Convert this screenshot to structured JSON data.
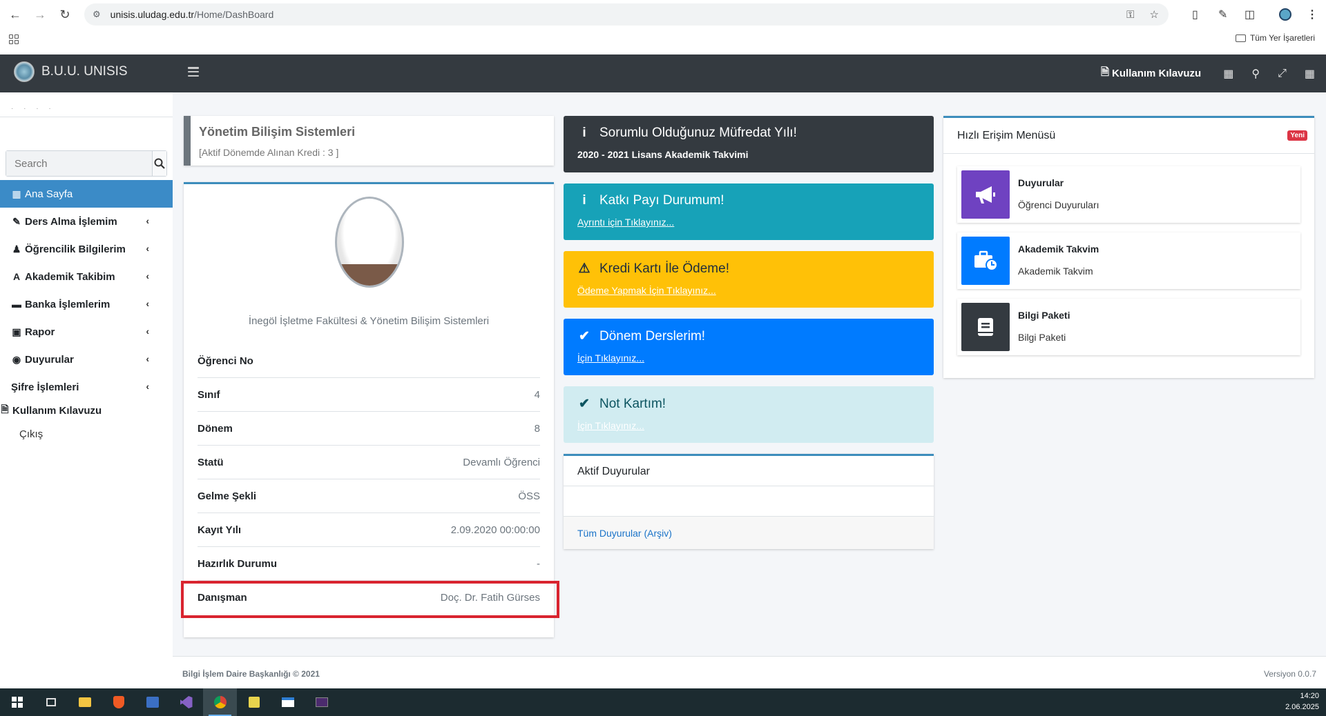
{
  "browser": {
    "url_host": "unisis.uludag.edu.tr",
    "url_path": "/Home/DashBoard",
    "bookmarks_all": "Tüm Yer İşaretleri"
  },
  "header": {
    "brand": "B.U.U. UNISIS",
    "guide": "Kullanım Kılavuzu"
  },
  "sidebar": {
    "search_placeholder": "Search",
    "items": [
      {
        "label": "Ana Sayfa",
        "icon": "dashboard-icon"
      },
      {
        "label": "Ders Alma İşlemim",
        "icon": "pencil-icon"
      },
      {
        "label": "Öğrencilik Bilgilerim",
        "icon": "graduate-icon"
      },
      {
        "label": "Akademik Takibim",
        "icon": "font-icon"
      },
      {
        "label": "Banka İşlemlerim",
        "icon": "wallet-icon"
      },
      {
        "label": "Rapor",
        "icon": "folder-icon"
      },
      {
        "label": "Duyurular",
        "icon": "location-icon"
      },
      {
        "label": "Şifre İşlemleri",
        "icon": ""
      }
    ],
    "guide": "Kullanım Kılavuzu",
    "logout": "Çıkış"
  },
  "program": {
    "title": "Yönetim Bilişim Sistemleri",
    "credit": "[Aktif Dönemde Alınan Kredi : 3 ]"
  },
  "profile": {
    "faculty": "İnegöl İşletme Fakültesi & Yönetim Bilişim Sistemleri",
    "rows": [
      {
        "k": "Öğrenci No",
        "v": ""
      },
      {
        "k": "Sınıf",
        "v": "4"
      },
      {
        "k": "Dönem",
        "v": "8"
      },
      {
        "k": "Statü",
        "v": "Devamlı Öğrenci"
      },
      {
        "k": "Gelme Şekli",
        "v": "ÖSS"
      },
      {
        "k": "Kayıt Yılı",
        "v": "2.09.2020 00:00:00"
      },
      {
        "k": "Hazırlık Durumu",
        "v": "-"
      },
      {
        "k": "Danışman",
        "v": "Doç. Dr. Fatih Gürses"
      }
    ]
  },
  "alerts": [
    {
      "title": "Sorumlu Olduğunuz Müfredat Yılı!",
      "text": "2020 - 2021 Lisans Akademik Takvimi",
      "icon": "info-icon"
    },
    {
      "title": "Katkı Payı Durumum!",
      "text": "Ayrıntı için Tıklayınız...",
      "icon": "info-icon"
    },
    {
      "title": "Kredi Kartı İle Ödeme!",
      "text": "Ödeme Yapmak İçin Tıklayınız...",
      "icon": "warning-icon"
    },
    {
      "title": "Dönem Derslerim!",
      "text": "İçin Tıklayınız...",
      "icon": "check-icon"
    },
    {
      "title": "Not Kartım!",
      "text": "İçin Tıklayınız...",
      "icon": "check-icon"
    }
  ],
  "announcements": {
    "title": "Aktif Duyurular",
    "archive": "Tüm Duyurular (Arşiv)"
  },
  "quick": {
    "title": "Hızlı Erişim Menüsü",
    "badge": "Yeni",
    "items": [
      {
        "title": "Duyurular",
        "sub": "Öğrenci Duyuruları",
        "color": "#6f42c1",
        "icon": "megaphone-icon"
      },
      {
        "title": "Akademik Takvim",
        "sub": "Akademik Takvim",
        "color": "#007bff",
        "icon": "briefcase-clock-icon"
      },
      {
        "title": "Bilgi Paketi",
        "sub": "Bilgi Paketi",
        "color": "#343a40",
        "icon": "book-icon"
      }
    ]
  },
  "footer": {
    "left": "Bilgi İşlem Daire Başkanlığı © 2021",
    "right": "Versiyon 0.0.7"
  },
  "taskbar": {
    "time": "14:20",
    "date": "2.06.2025"
  }
}
